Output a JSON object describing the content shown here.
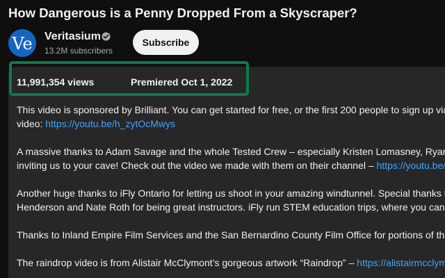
{
  "video": {
    "title": "How Dangerous is a Penny Dropped From a Skyscraper?",
    "views": "11,991,354 views",
    "premiered": "Premiered Oct 1, 2022"
  },
  "channel": {
    "avatar_text": "Ve",
    "name": "Veritasium",
    "subscribers": "13.2M subscribers",
    "verified_icon": "verified-check-icon",
    "subscribe_label": "Subscribe"
  },
  "colors": {
    "background": "#0f0f0f",
    "description_bg": "#272727",
    "link": "#3ea6ff",
    "highlight_border": "#0b7c4a",
    "avatar_bg": "#1565c0"
  },
  "description": {
    "p1": {
      "line1": "This video is sponsored by Brilliant. You can get started for free, or the first 200 people to sign up via this",
      "line2_pre": "video: ",
      "line2_link": "https://youtu.be/h_zytOcMwys"
    },
    "p2": {
      "line1": "A massive thanks to Adam Savage and the whole Tested Crew – especially Kristen Lomasney, Ryan",
      "line2_pre": "inviting us to your cave! Check out the video we made with them on their channel – ",
      "line2_link": "https://youtu.be/"
    },
    "p3": {
      "line1": "Another huge thanks to iFly Ontario for letting us shoot in your amazing windtunnel. Special thanks to",
      "line2": "Henderson and Nate Roth for being great instructors. iFly run STEM education trips, where you can e"
    },
    "p4": {
      "line1": "Thanks to Inland Empire Film Services and the San Bernardino County Film Office for portions of the"
    },
    "p5": {
      "line1_pre": "The raindrop video is from Alistair McClymont’s gorgeous artwork “Raindrop” – ",
      "line1_link": "https://alistairmcclymont.com"
    }
  }
}
